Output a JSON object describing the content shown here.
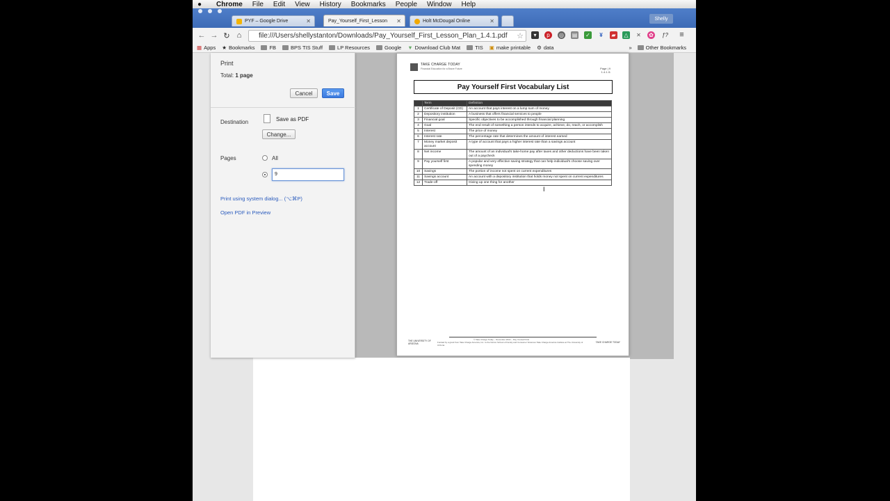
{
  "menubar": {
    "app": "Chrome",
    "items": [
      "File",
      "Edit",
      "View",
      "History",
      "Bookmarks",
      "People",
      "Window",
      "Help"
    ]
  },
  "tabs": [
    {
      "label": "PYF – Google Drive"
    },
    {
      "label": "Pay_Yourself_First_Lesson"
    },
    {
      "label": "Holt McDougal Online"
    }
  ],
  "profile": "Shelly",
  "address": "file:///Users/shellystanton/Downloads/Pay_Yourself_First_Lesson_Plan_1.4.1.pdf",
  "bookmarks": [
    "Apps",
    "Bookmarks",
    "FB",
    "BPS TIS Stuff",
    "LP Resources",
    "Google",
    "Download Club Mat",
    "TIS",
    "make printable",
    "data"
  ],
  "bookmarks_other": "Other Bookmarks",
  "print": {
    "title": "Print",
    "total_prefix": "Total: ",
    "total_value": "1 page",
    "cancel": "Cancel",
    "save": "Save",
    "destination_label": "Destination",
    "destination_value": "Save as PDF",
    "change": "Change...",
    "pages_label": "Pages",
    "pages_all": "All",
    "pages_value": "9",
    "system_dialog": "Print using system dialog... (⌥⌘P)",
    "open_preview": "Open PDF in Preview"
  },
  "document": {
    "logo_title": "TAKE CHARGE TODAY",
    "logo_subtitle": "Financial Education for a Brave Future",
    "page_line1": "Page | 9",
    "page_line2": "1.4.1.I1",
    "title": "Pay Yourself First Vocabulary List",
    "table": {
      "headers": [
        "",
        "Term",
        "Definition"
      ],
      "rows": [
        [
          "1",
          "Certificate of Deposit (CD)",
          "An account that pays interest on a lump sum of money"
        ],
        [
          "2",
          "Depository institution",
          "A business that offers financial services to people"
        ],
        [
          "3",
          "Financial goal",
          "Specific objectives to be accomplished through financial planning"
        ],
        [
          "4",
          "Goal",
          "The end result of something a person intends to acquire, achieve, do, reach, or accomplish"
        ],
        [
          "5",
          "Interest",
          "The price of money"
        ],
        [
          "6",
          "Interest rate",
          "The percentage rate that determines the amount of interest earned"
        ],
        [
          "7",
          "Money market deposit account",
          "A type of account that pays a higher interest rate than a savings account"
        ],
        [
          "8",
          "Net income",
          "The amount of an individual's take-home pay after taxes and other deductions have been taken out of a paycheck"
        ],
        [
          "9",
          "Pay yourself first",
          "A popular and very effective saving strategy that can help individual's choose saving over spending money"
        ],
        [
          "10",
          "Savings",
          "The portion of income not spent on current expenditures"
        ],
        [
          "11",
          "Savings account",
          "An account with a depository institution that holds money not spent on current expenditures"
        ],
        [
          "12",
          "Trade-off",
          "Giving up one thing for another"
        ]
      ]
    },
    "footer_center": "© Take Charge Today – November 2014 – Pay Yourself First",
    "footer_university": "THE UNIVERSITY OF ARIZONA",
    "footer_funding": "Funded by a grant from Take Charge America, Inc. to the Norton School of Family and Consumer Sciences Take Charge America Institute at The University of Arizona",
    "footer_logo": "TAKE CHARGE TODAY"
  },
  "colors": {
    "chrome_blue": "#4a78c4",
    "save_button": "#4285f4",
    "link": "#2a5bbd"
  }
}
